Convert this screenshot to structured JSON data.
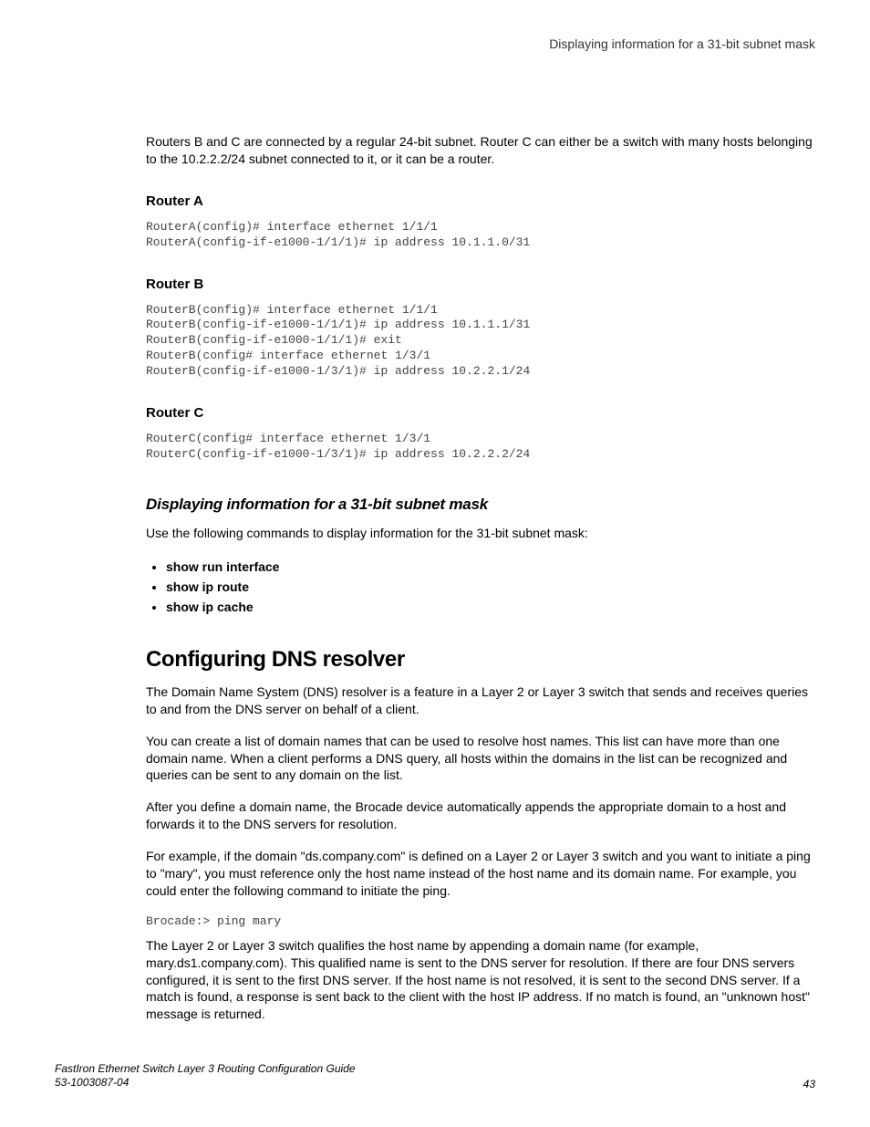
{
  "header": {
    "running_title": "Displaying information for a 31-bit subnet mask"
  },
  "intro_paragraph": "Routers B and C are connected by a regular 24-bit subnet. Router C can either be a switch with many hosts belonging to the 10.2.2.2/24 subnet connected to it, or it can be a router.",
  "router_a": {
    "heading": "Router A",
    "code": "RouterA(config)# interface ethernet 1/1/1\nRouterA(config-if-e1000-1/1/1)# ip address 10.1.1.0/31"
  },
  "router_b": {
    "heading": "Router B",
    "code": "RouterB(config)# interface ethernet 1/1/1\nRouterB(config-if-e1000-1/1/1)# ip address 10.1.1.1/31\nRouterB(config-if-e1000-1/1/1)# exit\nRouterB(config# interface ethernet 1/3/1\nRouterB(config-if-e1000-1/3/1)# ip address 10.2.2.1/24"
  },
  "router_c": {
    "heading": "Router C",
    "code": "RouterC(config# interface ethernet 1/3/1\nRouterC(config-if-e1000-1/3/1)# ip address 10.2.2.2/24"
  },
  "displaying_section": {
    "title": "Displaying information for a 31-bit subnet mask",
    "intro": "Use the following commands to display information for the 31-bit subnet mask:",
    "bullets": [
      "show run interface",
      "show ip route",
      "show ip cache"
    ]
  },
  "dns_section": {
    "title": "Configuring DNS resolver",
    "p1": "The Domain Name System (DNS) resolver is a feature in a Layer 2 or Layer 3 switch that sends and receives queries to and from the DNS server on behalf of a client.",
    "p2": "You can create a list of domain names that can be used to resolve host names. This list can have more than one domain name. When a client performs a DNS query, all hosts within the domains in the list can be recognized and queries can be sent to any domain on the list.",
    "p3": "After you define a domain name, the Brocade device automatically appends the appropriate domain to a host and forwards it to the DNS servers for resolution.",
    "p4": "For example, if the domain \"ds.company.com\" is defined on a Layer 2 or Layer 3 switch and you want to initiate a ping to \"mary\", you must reference only the host name instead of the host name and its domain name. For example, you could enter the following command to initiate the ping.",
    "code": "Brocade:> ping mary",
    "p5": "The Layer 2 or Layer 3 switch qualifies the host name by appending a domain name (for example, mary.ds1.company.com). This qualified name is sent to the DNS server for resolution. If there are four DNS servers configured, it is sent to the first DNS server. If the host name is not resolved, it is sent to the second DNS server. If a match is found, a response is sent back to the client with the host IP address. If no match is found, an \"unknown host\" message is returned."
  },
  "footer": {
    "book_title": "FastIron Ethernet Switch Layer 3 Routing Configuration Guide",
    "doc_number": "53-1003087-04",
    "page_number": "43"
  }
}
